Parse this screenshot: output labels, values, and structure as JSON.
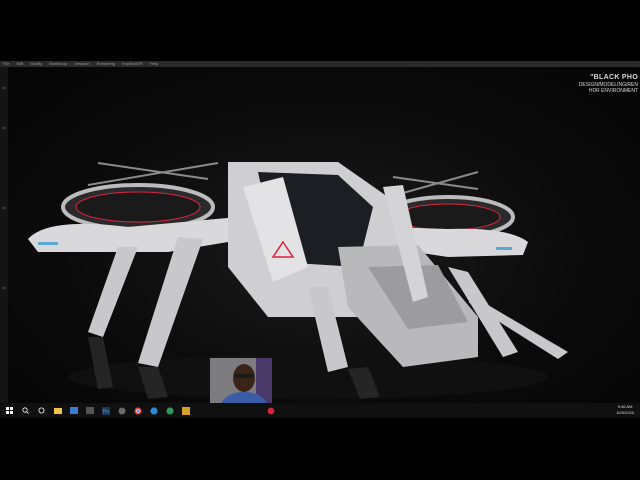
{
  "app": {
    "menu": [
      "File",
      "Edit",
      "Modify",
      "Workshop",
      "Viewport",
      "Rendering",
      "KeyShotXR",
      "Help"
    ]
  },
  "viewport": {
    "overlay_title": "\"BLACK PHO",
    "overlay_lines": [
      "DESIGN/MODELING/REN",
      "HDR ENVIRONMENT"
    ]
  },
  "taskbar": {
    "start": "windows-logo",
    "icons": [
      "search-icon",
      "task-view-icon",
      "file-explorer-icon",
      "store-icon",
      "media-icon",
      "photoshop-icon",
      "app-icon",
      "chrome-icon",
      "edge-icon",
      "app-icon",
      "app-icon",
      "record-icon"
    ],
    "time": "9:46 AM",
    "date": "10/5/2020"
  },
  "colors": {
    "accent_red": "#d8243a",
    "hull": "#d9d9db",
    "taskbar": "#101010"
  }
}
